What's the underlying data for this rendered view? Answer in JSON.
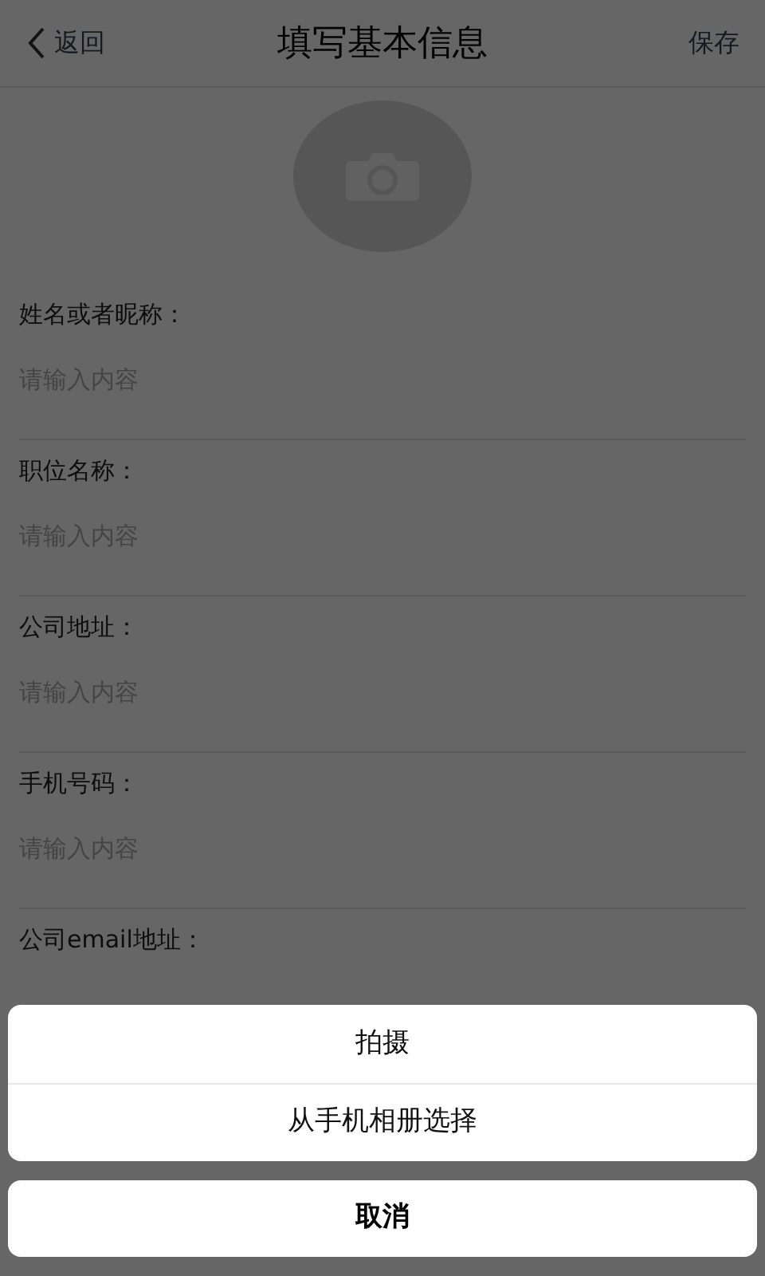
{
  "header": {
    "back": "返回",
    "title": "填写基本信息",
    "save": "保存"
  },
  "fields": [
    {
      "label": "姓名或者昵称：",
      "placeholder": "请输入内容"
    },
    {
      "label": "职位名称：",
      "placeholder": "请输入内容"
    },
    {
      "label": "公司地址：",
      "placeholder": "请输入内容"
    },
    {
      "label": "手机号码：",
      "placeholder": "请输入内容"
    },
    {
      "label": "公司email地址："
    }
  ],
  "action_sheet": {
    "options": [
      "拍摄",
      "从手机相册选择"
    ],
    "cancel": "取消"
  }
}
